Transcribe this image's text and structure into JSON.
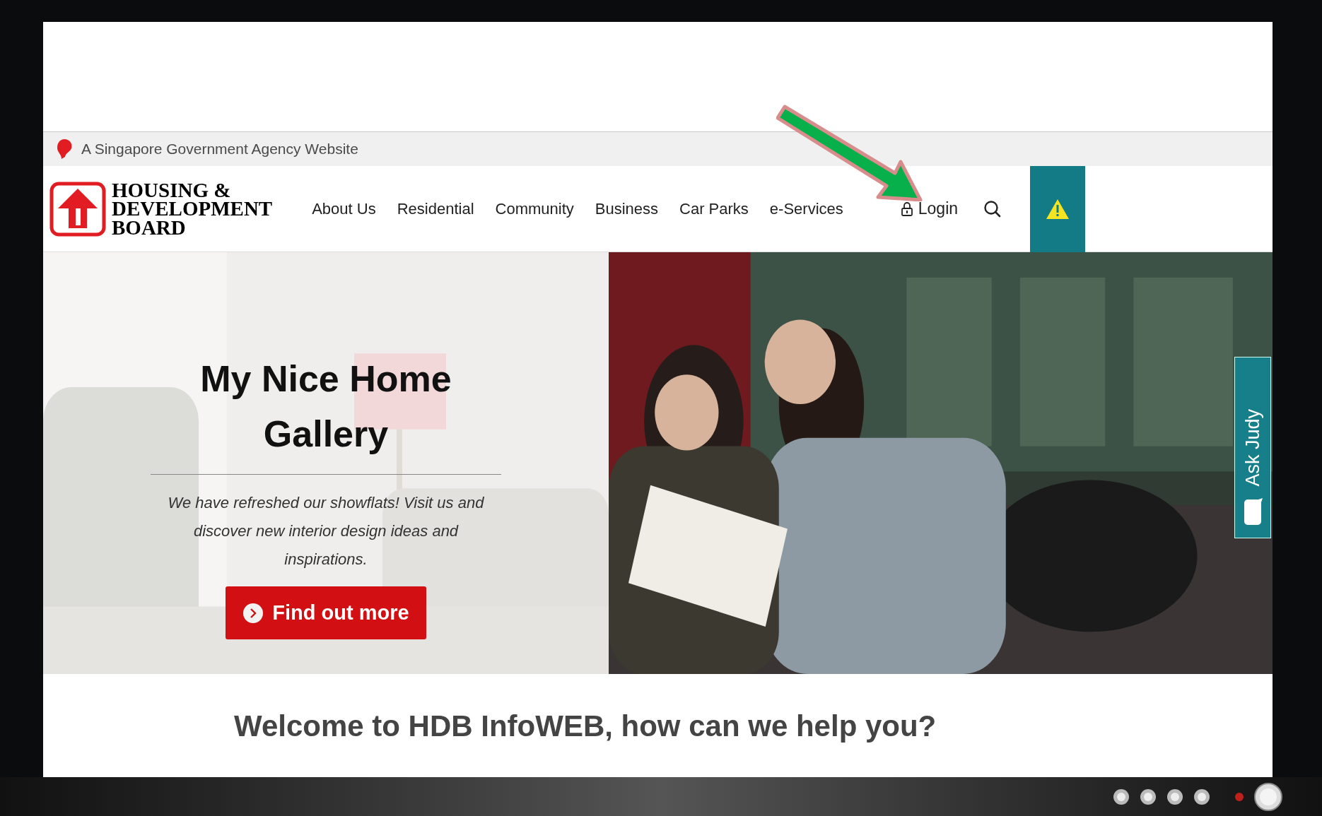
{
  "gov_bar": {
    "text": "A Singapore Government Agency Website"
  },
  "logo": {
    "lines": [
      "HOUSING &",
      "DEVELOPMENT",
      "BOARD"
    ]
  },
  "nav": {
    "items": [
      "About Us",
      "Residential",
      "Community",
      "Business",
      "Car Parks",
      "e-Services"
    ],
    "login": "Login"
  },
  "hero": {
    "title": "My Nice Home Gallery",
    "text": "We have refreshed our showflats! Visit us and discover new interior design ideas and inspirations.",
    "button": "Find out more"
  },
  "ask_judy": "Ask Judy",
  "welcome": "Welcome to HDB InfoWEB, how can we help you?"
}
